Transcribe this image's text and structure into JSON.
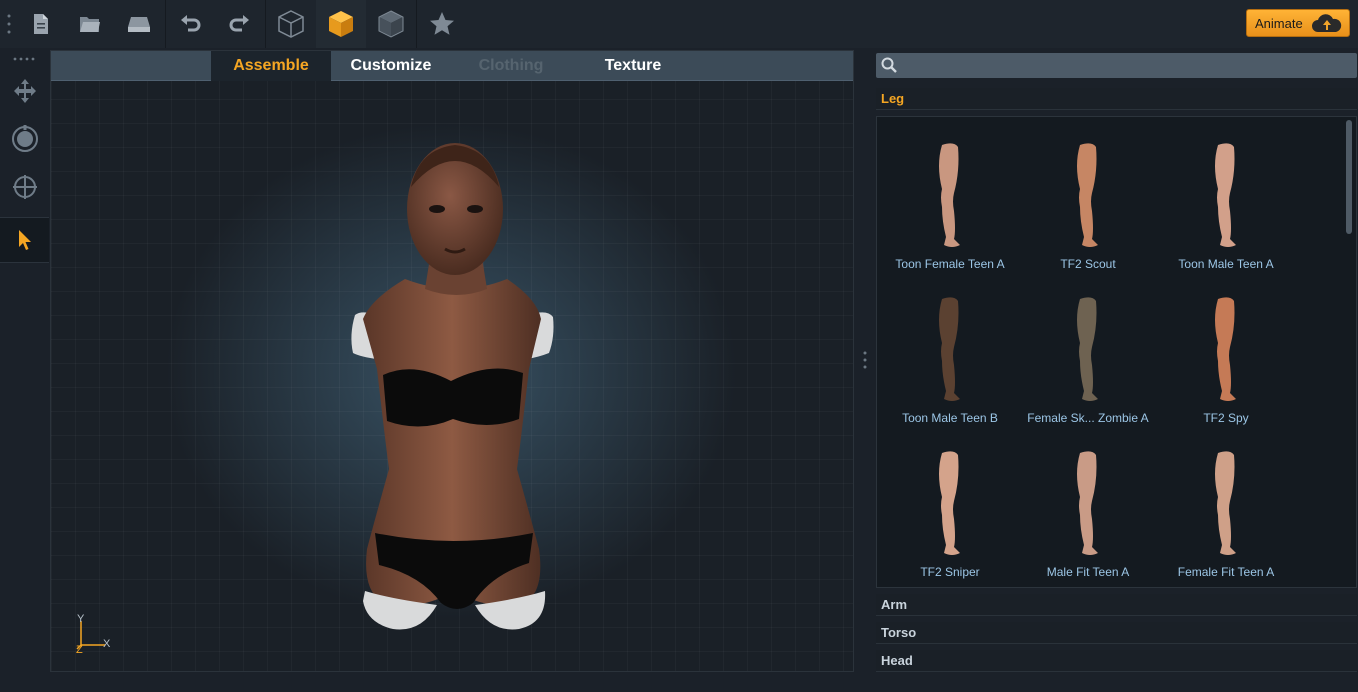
{
  "toolbar": {
    "buttons": [
      {
        "name": "new-file-icon"
      },
      {
        "name": "open-folder-icon"
      },
      {
        "name": "save-icon"
      },
      {
        "name": "undo-icon"
      },
      {
        "name": "redo-icon"
      },
      {
        "name": "wireframe-cube-icon"
      },
      {
        "name": "solid-cube-icon"
      },
      {
        "name": "textured-cube-icon"
      },
      {
        "name": "star-icon"
      }
    ],
    "animate_label": "Animate"
  },
  "tabs": [
    {
      "label": "Assemble",
      "state": "active"
    },
    {
      "label": "Customize",
      "state": "normal"
    },
    {
      "label": "Clothing",
      "state": "disabled"
    },
    {
      "label": "Texture",
      "state": "normal"
    }
  ],
  "axis": {
    "y": "Y",
    "z": "Z",
    "x": "X"
  },
  "search": {
    "placeholder": "",
    "value": ""
  },
  "categories": [
    {
      "label": "Leg",
      "open": true
    },
    {
      "label": "Arm",
      "open": false
    },
    {
      "label": "Torso",
      "open": false
    },
    {
      "label": "Head",
      "open": false
    }
  ],
  "assets": [
    {
      "label": "Toon Female Teen A",
      "skin": "#c99780"
    },
    {
      "label": "TF2 Scout",
      "skin": "#c68664"
    },
    {
      "label": "Toon Male Teen A",
      "skin": "#d2a08a"
    },
    {
      "label": "Toon Male Teen B",
      "skin": "#5b4131"
    },
    {
      "label": "Female Sk... Zombie A",
      "skin": "#6e6251"
    },
    {
      "label": "TF2 Spy",
      "skin": "#c57a56"
    },
    {
      "label": "TF2 Sniper",
      "skin": "#d4a38b"
    },
    {
      "label": "Male Fit Teen A",
      "skin": "#c99b86"
    },
    {
      "label": "Female Fit Teen A",
      "skin": "#cfa088"
    }
  ],
  "colors": {
    "accent": "#f5a623",
    "panel": "#1b2129",
    "tab_bar": "#3c4b58"
  }
}
